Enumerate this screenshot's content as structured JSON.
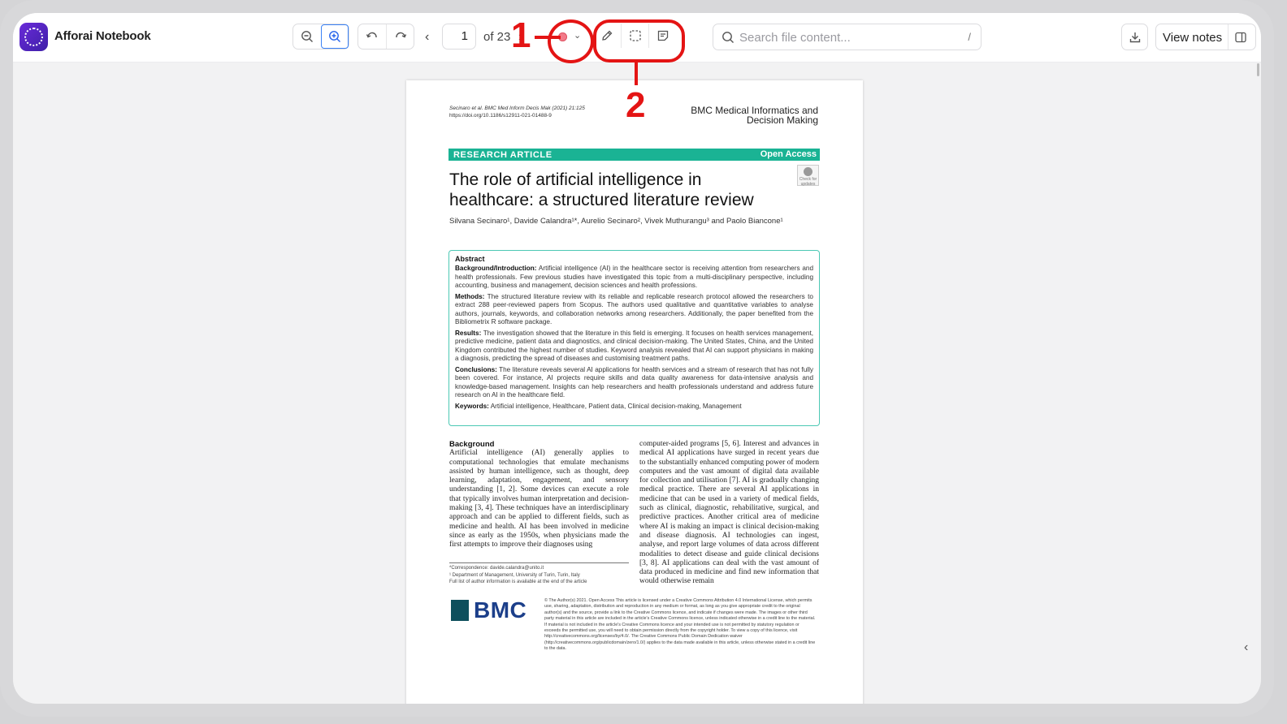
{
  "app": {
    "title": "Afforai Notebook"
  },
  "toolbar": {
    "page_current": "1",
    "page_of": "of 23",
    "search_placeholder": "Search file content...",
    "search_shortcut": "/",
    "view_notes_label": "View notes",
    "highlight_color": "#f27b8a"
  },
  "annotations": {
    "label1": "1",
    "label2": "2",
    "color": "#e41414"
  },
  "paper": {
    "citation": "Secinaro et al. BMC Med Inform Decis Mak     (2021) 21:125",
    "doi": "https://doi.org/10.1186/s12911-021-01488-9",
    "journal": "BMC Medical Informatics and Decision Making",
    "band_left": "RESEARCH ARTICLE",
    "band_right": "Open Access",
    "check_label": "Check for updates",
    "title": "The role of artificial intelligence in healthcare: a structured literature review",
    "authors": "Silvana Secinaro¹, Davide Calandra¹*, Aurelio Secinaro², Vivek Muthurangu³ and Paolo Biancone¹",
    "abstract": {
      "heading": "Abstract",
      "sections": [
        {
          "label": "Background/Introduction:",
          "text": "Artificial intelligence (AI) in the healthcare sector is receiving attention from researchers and health professionals. Few previous studies have investigated this topic from a multi-disciplinary perspective, including accounting, business and management, decision sciences and health professions."
        },
        {
          "label": "Methods:",
          "text": "The structured literature review with its reliable and replicable research protocol allowed the researchers to extract 288 peer-reviewed papers from Scopus. The authors used qualitative and quantitative variables to analyse authors, journals, keywords, and collaboration networks among researchers. Additionally, the paper benefited from the Bibliometrix R software package."
        },
        {
          "label": "Results:",
          "text": "The investigation showed that the literature in this field is emerging. It focuses on health services management, predictive medicine, patient data and diagnostics, and clinical decision-making. The United States, China, and the United Kingdom contributed the highest number of studies. Keyword analysis revealed that AI can support physicians in making a diagnosis, predicting the spread of diseases and customising treatment paths."
        },
        {
          "label": "Conclusions:",
          "text": "The literature reveals several AI applications for health services and a stream of research that has not fully been covered. For instance, AI projects require skills and data quality awareness for data-intensive analysis and knowledge-based management. Insights can help researchers and health professionals understand and address future research on AI in the healthcare field."
        },
        {
          "label": "Keywords:",
          "text": "Artificial intelligence, Healthcare, Patient data, Clinical decision-making, Management"
        }
      ]
    },
    "background_heading": "Background",
    "body_left": "Artificial intelligence (AI) generally applies to computational technologies that emulate mechanisms assisted by human intelligence, such as thought, deep learning, adaptation, engagement, and sensory understanding [1, 2]. Some devices can execute a role that typically involves human interpretation and decision-making [3, 4]. These techniques have an interdisciplinary approach and can be applied to different fields, such as medicine and health. AI has been involved in medicine since as early as the 1950s, when physicians made the first attempts to improve their diagnoses using",
    "body_right": "computer-aided programs [5, 6]. Interest and advances in medical AI applications have surged in recent years due to the substantially enhanced computing power of modern computers and the vast amount of digital data available for collection and utilisation [7]. AI is gradually changing medical practice. There are several AI applications in medicine that can be used in a variety of medical fields, such as clinical, diagnostic, rehabilitative, surgical, and predictive practices. Another critical area of medicine where AI is making an impact is clinical decision-making and disease diagnosis. AI technologies can ingest, analyse, and report large volumes of data across different modalities to detect disease and guide clinical decisions [3, 8]. AI applications can deal with the vast amount of data produced in medicine and find new information that would otherwise remain",
    "footnotes": [
      "*Correspondence: davide.calandra@unito.it",
      "¹ Department of Management, University of Turin, Turin, Italy",
      "Full list of author information is available at the end of the article"
    ],
    "publisher_logo": "BMC",
    "license": "© The Author(s) 2021. Open Access This article is licensed under a Creative Commons Attribution 4.0 International License, which permits use, sharing, adaptation, distribution and reproduction in any medium or format, as long as you give appropriate credit to the original author(s) and the source, provide a link to the Creative Commons licence, and indicate if changes were made. The images or other third party material in this article are included in the article's Creative Commons licence, unless indicated otherwise in a credit line to the material. If material is not included in the article's Creative Commons licence and your intended use is not permitted by statutory regulation or exceeds the permitted use, you will need to obtain permission directly from the copyright holder. To view a copy of this licence, visit http://creativecommons.org/licenses/by/4.0/. The Creative Commons Public Domain Dedication waiver (http://creativecommons.org/publicdomain/zero/1.0/) applies to the data made available in this article, unless otherwise stated in a credit line to the data."
  }
}
